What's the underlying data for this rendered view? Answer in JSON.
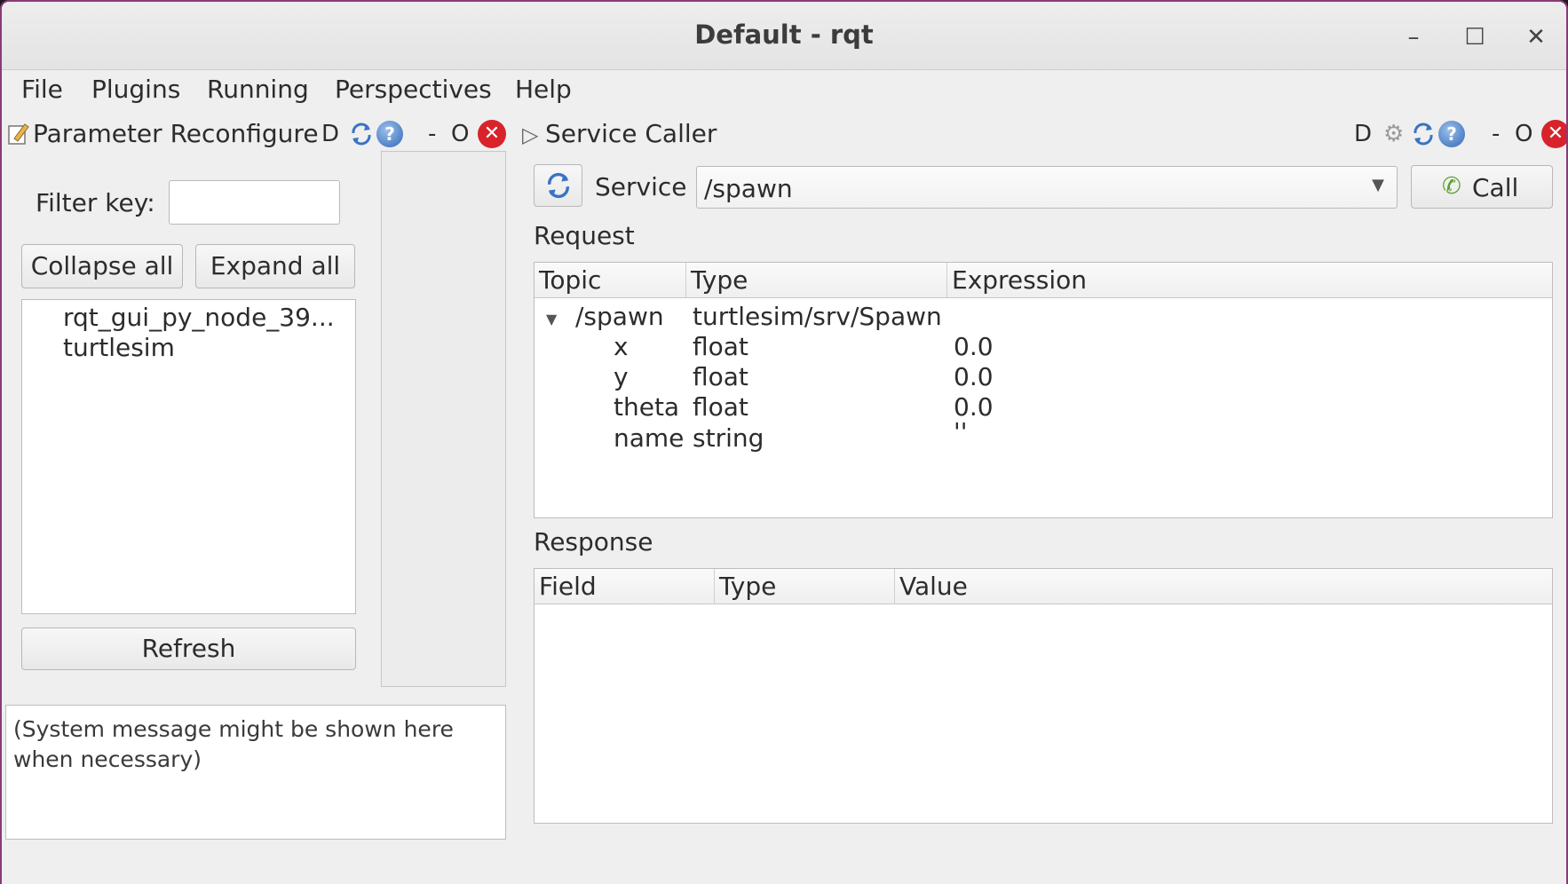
{
  "window": {
    "title": "Default - rqt"
  },
  "menu": {
    "items": [
      {
        "label": "File"
      },
      {
        "label": "Plugins"
      },
      {
        "label": "Running"
      },
      {
        "label": "Perspectives"
      },
      {
        "label": "Help"
      }
    ]
  },
  "param_dock": {
    "title": "Parameter Reconfigure",
    "d_label": "D",
    "min_label": "-",
    "float_label": "O",
    "filter_label": "Filter key:",
    "filter_value": "",
    "collapse_label": "Collapse all",
    "expand_label": "Expand all",
    "nodes": [
      "rqt_gui_py_node_39...",
      "turtlesim"
    ],
    "refresh_label": "Refresh",
    "system_message": "(System message might be shown here when necessary)"
  },
  "service_dock": {
    "title": "Service Caller",
    "d_label": "D",
    "min_label": "-",
    "float_label": "O",
    "service_label": "Service",
    "service_value": "/spawn",
    "call_label": "Call",
    "request_label": "Request",
    "request_columns": [
      "Topic",
      "Type",
      "Expression"
    ],
    "request_root": {
      "topic": "/spawn",
      "type": "turtlesim/srv/Spawn",
      "expression": ""
    },
    "request_rows": [
      {
        "topic": "x",
        "type": "float",
        "expression": "0.0"
      },
      {
        "topic": "y",
        "type": "float",
        "expression": "0.0"
      },
      {
        "topic": "theta",
        "type": "float",
        "expression": "0.0"
      },
      {
        "topic": "name",
        "type": "string",
        "expression": "''"
      }
    ],
    "response_label": "Response",
    "response_columns": [
      "Field",
      "Type",
      "Value"
    ]
  },
  "colors": {
    "close": "#d8232a",
    "accent": "#2f68b8",
    "call_icon": "#5aa02c"
  }
}
